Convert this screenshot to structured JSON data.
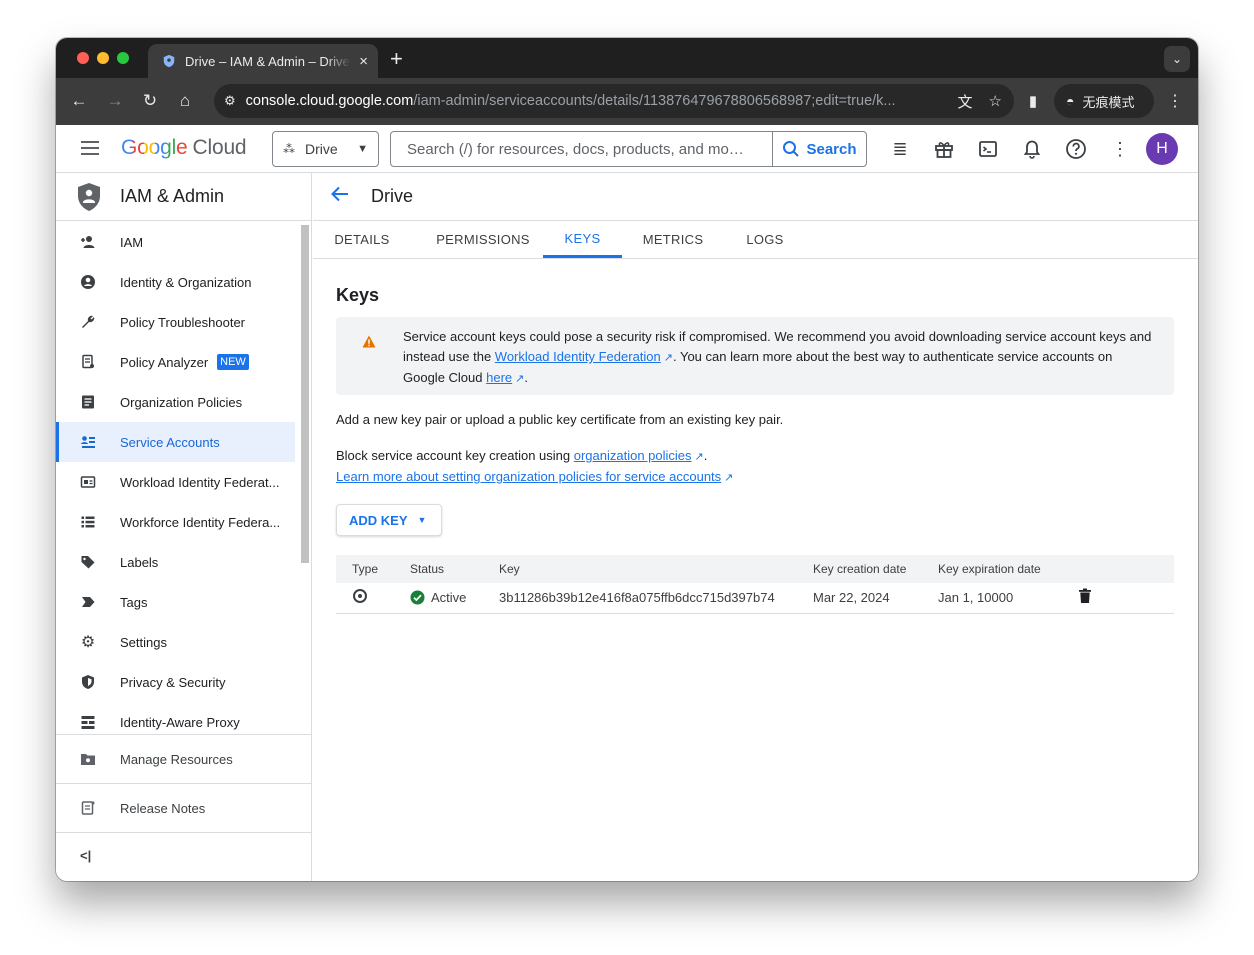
{
  "browser": {
    "tab_title": "Drive – IAM & Admin – Drive – ",
    "tab_close": "×",
    "new_tab": "+",
    "url_host": "console.cloud.google.com",
    "url_path": "/iam-admin/serviceaccounts/details/113876479678806568987;edit=true/k...",
    "incognito_label": "无痕模式"
  },
  "header": {
    "logo_google": "Google",
    "logo_cloud": "Cloud",
    "project": "Drive",
    "search_placeholder": "Search (/) for resources, docs, products, and mo…",
    "search_button": "Search",
    "avatar_initial": "H"
  },
  "sidebar": {
    "title": "IAM & Admin",
    "items": [
      {
        "label": "IAM",
        "icon": "person-add-icon"
      },
      {
        "label": "Identity & Organization",
        "icon": "account-circle-icon"
      },
      {
        "label": "Policy Troubleshooter",
        "icon": "wrench-icon"
      },
      {
        "label": "Policy Analyzer",
        "icon": "policy-document-icon",
        "badge": "NEW"
      },
      {
        "label": "Organization Policies",
        "icon": "list-document-icon"
      },
      {
        "label": "Service Accounts",
        "icon": "service-account-icon",
        "active": true
      },
      {
        "label": "Workload Identity Federat...",
        "icon": "id-card-icon"
      },
      {
        "label": "Workforce Identity Federa...",
        "icon": "list-icon"
      },
      {
        "label": "Labels",
        "icon": "label-icon"
      },
      {
        "label": "Tags",
        "icon": "tag-icon"
      },
      {
        "label": "Settings",
        "icon": "gear-icon"
      },
      {
        "label": "Privacy & Security",
        "icon": "shield-icon"
      },
      {
        "label": "Identity-Aware Proxy",
        "icon": "proxy-icon"
      }
    ],
    "manage_resources": "Manage Resources",
    "release_notes": "Release Notes",
    "collapse": "<|"
  },
  "page": {
    "title": "Drive",
    "tabs": [
      "DETAILS",
      "PERMISSIONS",
      "KEYS",
      "METRICS",
      "LOGS"
    ],
    "active_tab": "KEYS",
    "section_title": "Keys",
    "warning": {
      "before_link": "Service account keys could pose a security risk if compromised. We recommend you avoid downloading service account keys and instead use the ",
      "link1": "Workload Identity Federation",
      "middle": ". You can learn more about the best way to authenticate service accounts on Google Cloud ",
      "link2": "here",
      "end": "."
    },
    "add_pair_text": "Add a new key pair or upload a public key certificate from an existing key pair.",
    "block_text": "Block service account key creation using ",
    "block_link": "organization policies",
    "block_end": ".",
    "learn_more_link": "Learn more about setting organization policies for service accounts",
    "add_key_button": "ADD KEY",
    "table": {
      "headers": [
        "Type",
        "Status",
        "Key",
        "Key creation date",
        "Key expiration date"
      ],
      "rows": [
        {
          "status": "Active",
          "key": "3b11286b39b12e416f8a075ffb6dcc715d397b74",
          "created": "Mar 22, 2024",
          "expires": "Jan 1, 10000"
        }
      ]
    }
  },
  "colors": {
    "accent": "#1a73e8",
    "warning": "#e37400",
    "success": "#188038",
    "avatar": "#6a3ab2"
  }
}
